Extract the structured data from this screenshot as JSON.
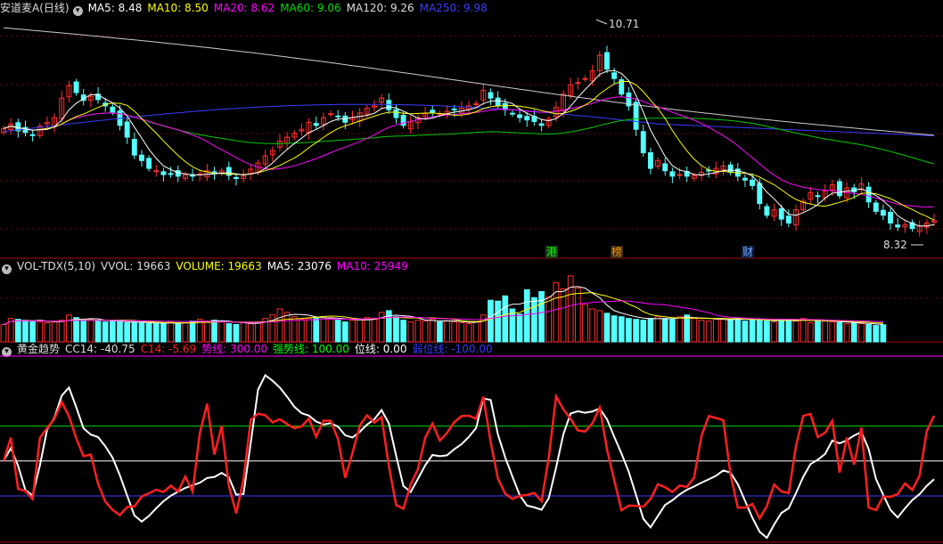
{
  "header": {
    "title": "安道麦A(日线)",
    "ma_items": [
      {
        "label": "MA5: 8.48",
        "color": "#ffffff"
      },
      {
        "label": "MA10: 8.50",
        "color": "#ffff00"
      },
      {
        "label": "MA20: 8.62",
        "color": "#ff00ff"
      },
      {
        "label": "MA60: 9.06",
        "color": "#00dd00"
      },
      {
        "label": "MA120: 9.26",
        "color": "#dddddd"
      },
      {
        "label": "MA250: 9.98",
        "color": "#3b3bff"
      }
    ]
  },
  "vol_header": {
    "items": [
      {
        "label": "VOL-TDX(5,10)",
        "color": "#dddddd"
      },
      {
        "label": "VVOL: 19663",
        "color": "#dddddd"
      },
      {
        "label": "VOLUME: 19663",
        "color": "#ffff00"
      },
      {
        "label": "MA5: 23076",
        "color": "#ffffff"
      },
      {
        "label": "MA10: 25949",
        "color": "#ff00ff"
      }
    ]
  },
  "ind_header": {
    "items": [
      {
        "label": "黄金趋势",
        "color": "#dddddd"
      },
      {
        "label": "CC14: -40.75",
        "color": "#dddddd"
      },
      {
        "label": "C14: -5.69",
        "color": "#ff2020"
      },
      {
        "label": "势线: 300.00",
        "color": "#ff00ff"
      },
      {
        "label": "强势线: 100.00",
        "color": "#00ff00"
      },
      {
        "label": "位线: 0.00",
        "color": "#ffffff"
      },
      {
        "label": "弱位线: -100.00",
        "color": "#3b3bff"
      }
    ]
  },
  "annotations": {
    "high_label": "10.71",
    "low_label": "8.32",
    "tags": [
      {
        "label": "港",
        "color": "#00ff00",
        "bg": "#1a3a1a"
      },
      {
        "label": "榜",
        "color": "#ff9900",
        "bg": "#3a2a10"
      },
      {
        "label": "财",
        "color": "#6fa8ff",
        "bg": "#102040"
      }
    ]
  },
  "chart_data": {
    "type": "candlestick",
    "y_range": [
      8.0,
      11.1
    ],
    "high": 10.71,
    "low": 8.32,
    "close_series": [
      9.66,
      9.72,
      9.63,
      9.61,
      9.57,
      9.69,
      9.74,
      9.8,
      10.05,
      10.21,
      10.12,
      10.02,
      10.07,
      10.03,
      9.95,
      9.87,
      9.7,
      9.55,
      9.32,
      9.25,
      9.15,
      9.12,
      9.07,
      9.08,
      9.05,
      9.07,
      9.05,
      9.08,
      9.12,
      9.08,
      9.12,
      9.06,
      9.02,
      9.05,
      9.14,
      9.22,
      9.31,
      9.38,
      9.5,
      9.55,
      9.6,
      9.65,
      9.74,
      9.7,
      9.8,
      9.85,
      9.82,
      9.74,
      9.8,
      9.86,
      9.92,
      9.95,
      10.05,
      9.9,
      9.8,
      9.7,
      9.75,
      9.8,
      9.85,
      9.87,
      9.85,
      9.88,
      9.9,
      9.92,
      9.95,
      9.98,
      10.15,
      10.05,
      9.95,
      9.9,
      9.85,
      9.8,
      9.77,
      9.75,
      9.7,
      9.78,
      9.93,
      10.1,
      10.22,
      10.25,
      10.3,
      10.4,
      10.6,
      10.42,
      10.3,
      10.1,
      9.95,
      9.65,
      9.35,
      9.15,
      9.25,
      9.12,
      9.05,
      9.07,
      9.05,
      9.06,
      9.1,
      9.12,
      9.15,
      9.18,
      9.1,
      9.05,
      9.0,
      8.93,
      8.7,
      8.55,
      8.62,
      8.5,
      8.45,
      8.62,
      8.73,
      8.84,
      8.79,
      8.86,
      8.94,
      8.8,
      8.9,
      8.85,
      8.95,
      8.72,
      8.6,
      8.55,
      8.45,
      8.4,
      8.43,
      8.38,
      8.41,
      8.45,
      8.48
    ],
    "volume_series": [
      20000,
      27000,
      26000,
      25000,
      24000,
      23000,
      22000,
      23000,
      25000,
      31000,
      28000,
      24000,
      26000,
      24000,
      23000,
      24000,
      23000,
      22000,
      23000,
      22000,
      21000,
      21000,
      22000,
      23000,
      21000,
      22000,
      24000,
      26000,
      24000,
      25000,
      23000,
      21000,
      20000,
      22000,
      21000,
      23000,
      27000,
      31000,
      38000,
      34000,
      29000,
      26000,
      27000,
      28000,
      29000,
      28000,
      25000,
      23000,
      25000,
      26000,
      28000,
      27000,
      34000,
      36000,
      29000,
      25000,
      23000,
      25000,
      24000,
      26000,
      23000,
      24000,
      23000,
      22000,
      21000,
      23000,
      31000,
      48000,
      47000,
      53000,
      38000,
      32000,
      60000,
      51000,
      58000,
      52000,
      68000,
      61000,
      76000,
      62000,
      43000,
      38000,
      36000,
      33000,
      30000,
      29000,
      27000,
      26000,
      25000,
      27000,
      29000,
      27000,
      26000,
      29000,
      31000,
      27000,
      25000,
      24000,
      26000,
      27000,
      26000,
      27000,
      24000,
      25000,
      26000,
      24000,
      23000,
      26000,
      25000,
      24000,
      27000,
      22000,
      25000,
      24000,
      23000,
      22000,
      21000,
      22000,
      21000,
      20000,
      19000,
      19663
    ],
    "indicator_lines": {
      "strong": 100,
      "zero": 0,
      "weak": -100
    },
    "cc14_latest": -40.75,
    "c14_latest": -5.69
  }
}
